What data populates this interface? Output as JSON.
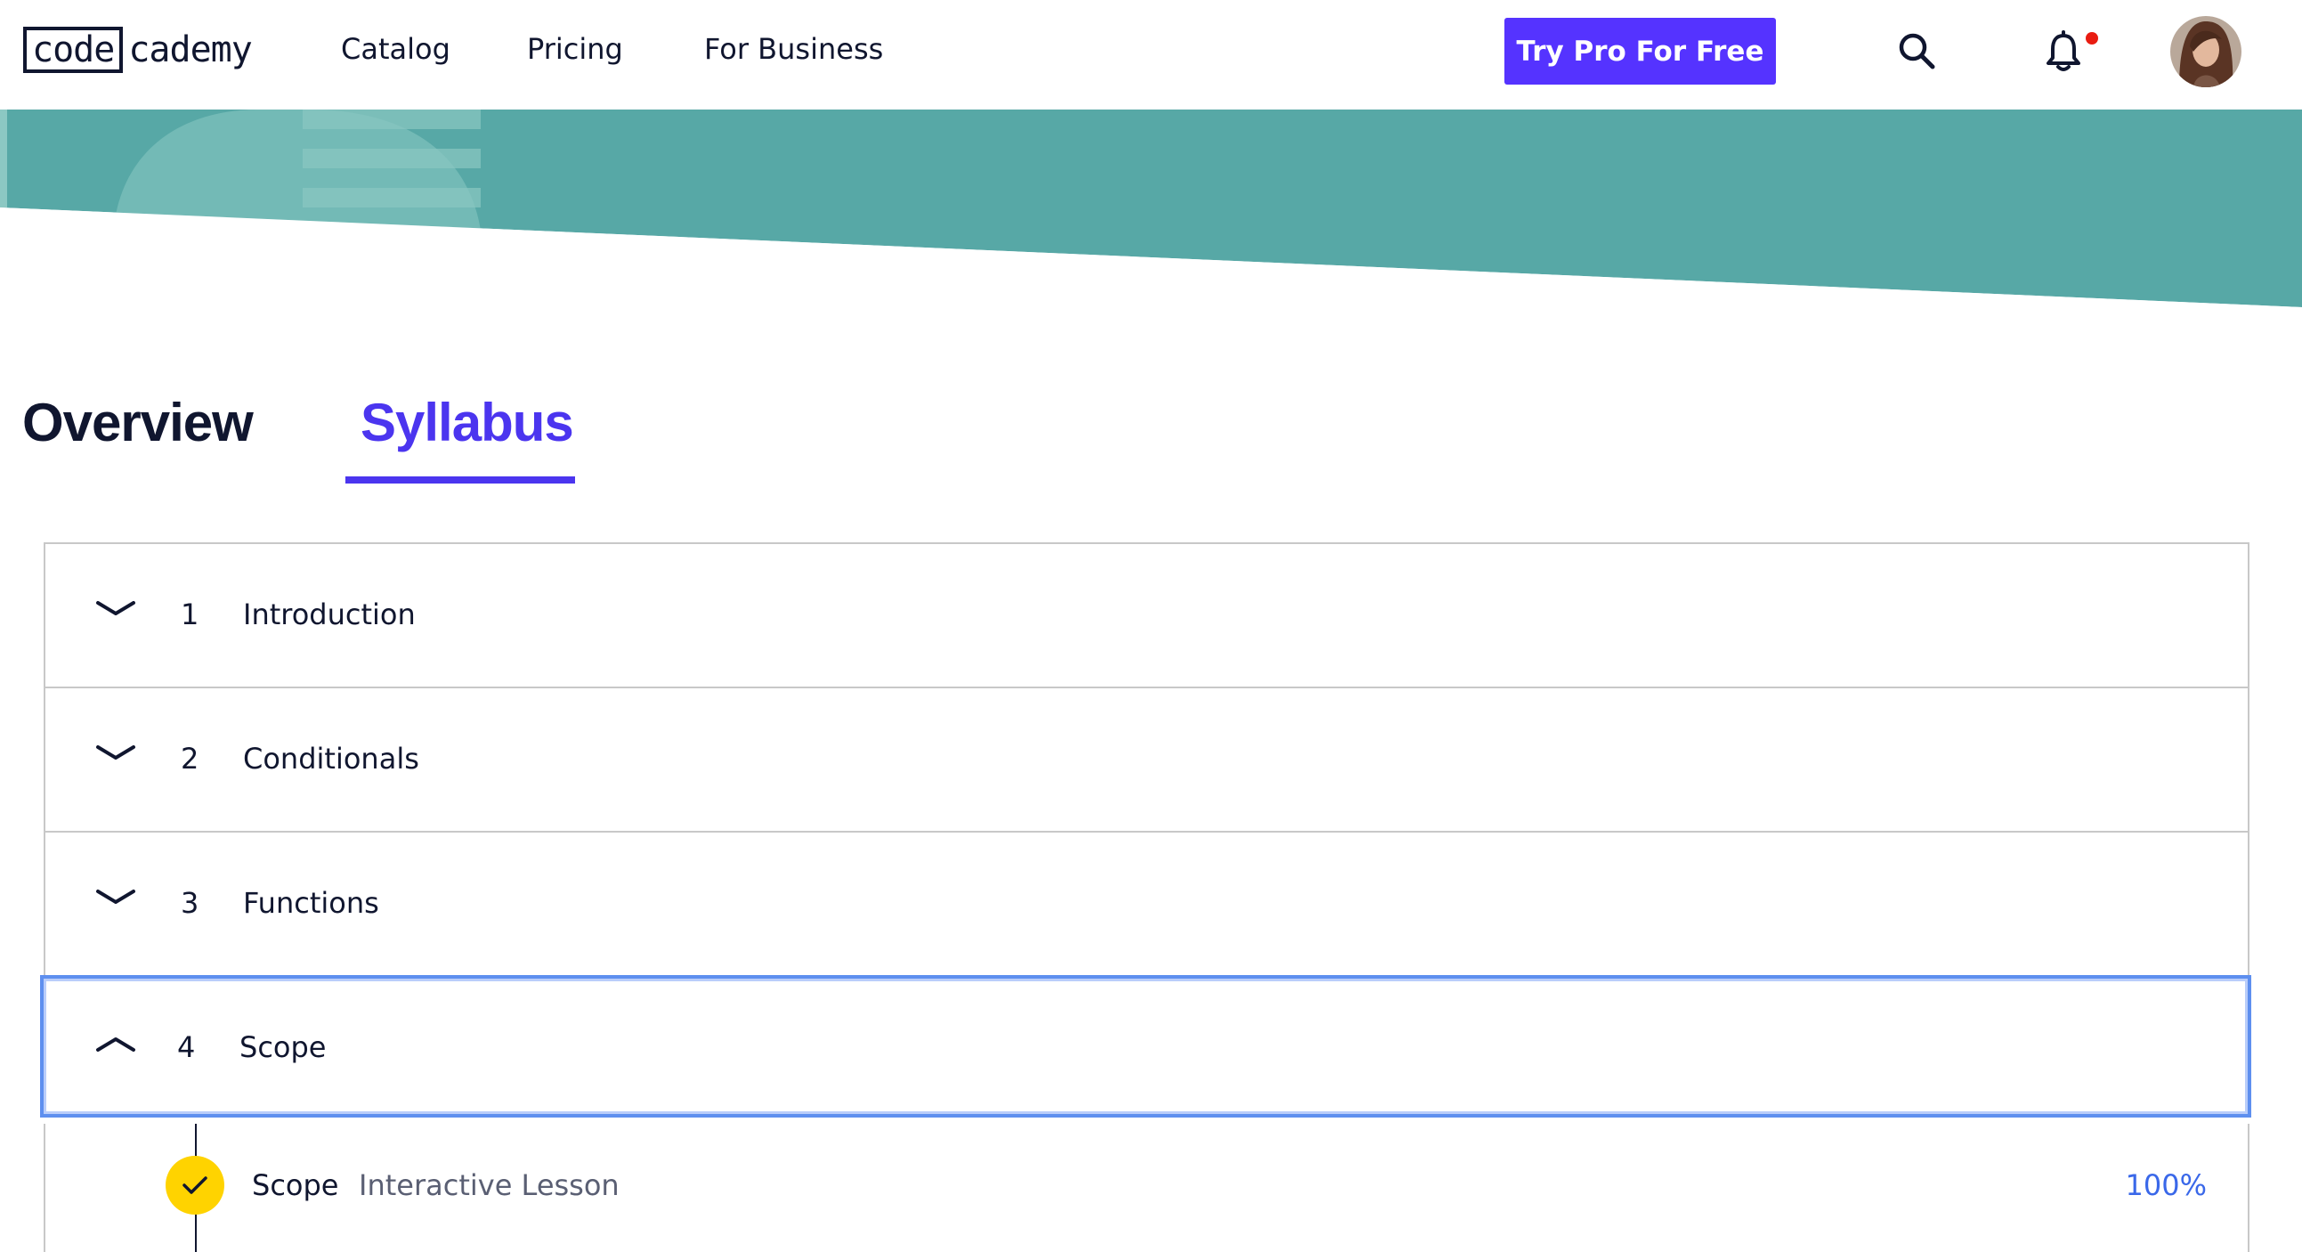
{
  "brand": {
    "logo_box": "code",
    "logo_rest": "cademy"
  },
  "nav": {
    "links": [
      "Catalog",
      "Pricing",
      "For Business"
    ],
    "cta_label": "Try Pro For Free"
  },
  "icons": {
    "search": "search-icon",
    "notifications": "bell-icon",
    "avatar": "user-avatar"
  },
  "colors": {
    "accent": "#5533ff",
    "tab_active": "#4b35ef",
    "hero_teal": "#57a8a6",
    "check_yellow": "#ffd300",
    "progress_blue": "#3a68e9",
    "notification_dot": "#e91c11"
  },
  "tabs": [
    {
      "label": "Overview",
      "active": false
    },
    {
      "label": "Syllabus",
      "active": true
    }
  ],
  "modules": [
    {
      "number": "1",
      "title": "Introduction",
      "expanded": false
    },
    {
      "number": "2",
      "title": "Conditionals",
      "expanded": false
    },
    {
      "number": "3",
      "title": "Functions",
      "expanded": false
    },
    {
      "number": "4",
      "title": "Scope",
      "expanded": true
    }
  ],
  "lessons": [
    {
      "title": "Scope",
      "type": "Interactive Lesson",
      "progress": "100%",
      "completed": true
    }
  ]
}
